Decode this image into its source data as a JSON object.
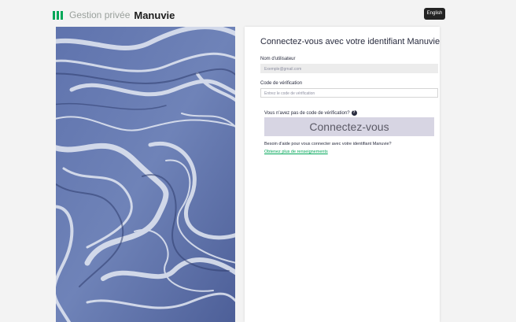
{
  "header": {
    "brand_prefix": "Gestion privée",
    "brand_name": "Manuvie",
    "language_button": "English"
  },
  "login": {
    "title": "Connectez-vous avec votre identifiant Manuvie",
    "username_label": "Nom d'utilisateur",
    "username_value": "Exemple@gmail.com",
    "code_label": "Code de vérification",
    "code_placeholder": "Entrez le code de vérification",
    "no_code_text": "Vous n'avez pas de code de vérification?",
    "submit_label": "Connectez-vous",
    "need_help_text": "Besoin d'aide pour vous connecter avec votre identifiant Manuvie?",
    "more_info_link": "Obtenez plus de renseignements"
  },
  "icons": {
    "help": "question-circle-icon",
    "brand": "manulife-bars-icon"
  },
  "colors": {
    "brand_green": "#00a758",
    "button_bg": "#d7d5e3",
    "header_bg": "#f3f3f3",
    "text_dark": "#282b3e"
  }
}
